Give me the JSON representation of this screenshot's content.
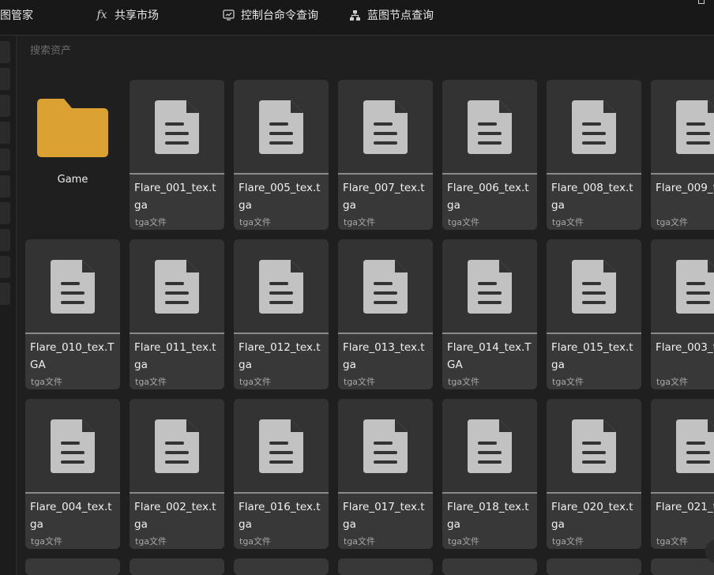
{
  "nav": {
    "items": [
      {
        "label": "图管家",
        "icon": "none"
      },
      {
        "label": "共享市场",
        "icon": "fx-icon"
      },
      {
        "label": "控制台命令查询",
        "icon": "console-icon"
      },
      {
        "label": "蓝图节点查询",
        "icon": "node-tree-icon"
      }
    ]
  },
  "search": {
    "placeholder": "搜索资产",
    "value": ""
  },
  "folder": {
    "label": "Game",
    "color": "#dba233"
  },
  "colors": {
    "card": "#383838",
    "thumb": "#333333",
    "doc_icon": "#c2c2c2",
    "background": "#1f1f1f"
  },
  "assets": [
    {
      "name": "Flare_001_tex.tga",
      "type": "tga文件"
    },
    {
      "name": "Flare_005_tex.tga",
      "type": "tga文件"
    },
    {
      "name": "Flare_007_tex.tga",
      "type": "tga文件"
    },
    {
      "name": "Flare_006_tex.tga",
      "type": "tga文件"
    },
    {
      "name": "Flare_008_tex.tga",
      "type": "tga文件"
    },
    {
      "name": "Flare_009_t",
      "type": "tga文件"
    },
    {
      "name": "Flare_010_tex.TGA",
      "type": "tga文件"
    },
    {
      "name": "Flare_011_tex.tga",
      "type": "tga文件"
    },
    {
      "name": "Flare_012_tex.tga",
      "type": "tga文件"
    },
    {
      "name": "Flare_013_tex.tga",
      "type": "tga文件"
    },
    {
      "name": "Flare_014_tex.TGA",
      "type": "tga文件"
    },
    {
      "name": "Flare_015_tex.tga",
      "type": "tga文件"
    },
    {
      "name": "Flare_003_t",
      "type": "tga文件"
    },
    {
      "name": "Flare_004_tex.tga",
      "type": "tga文件"
    },
    {
      "name": "Flare_002_tex.tga",
      "type": "tga文件"
    },
    {
      "name": "Flare_016_tex.tga",
      "type": "tga文件"
    },
    {
      "name": "Flare_017_tex.tga",
      "type": "tga文件"
    },
    {
      "name": "Flare_018_tex.tga",
      "type": "tga文件"
    },
    {
      "name": "Flare_020_tex.tga",
      "type": "tga文件"
    },
    {
      "name": "Flare_021_t",
      "type": "tga文件"
    }
  ]
}
